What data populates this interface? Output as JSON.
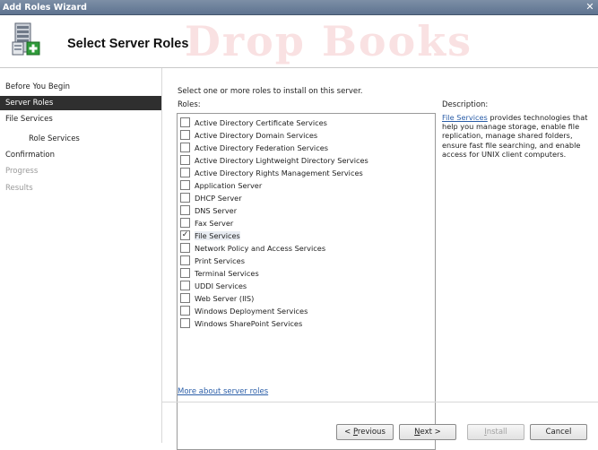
{
  "window": {
    "title": "Add Roles Wizard",
    "close_glyph": "✕"
  },
  "header": {
    "title": "Select Server Roles",
    "icon": "server-roles-wizard-icon"
  },
  "watermark": {
    "text": "Drop Books"
  },
  "nav": {
    "items": [
      {
        "label": "Before You Begin",
        "state": "normal"
      },
      {
        "label": "Server Roles",
        "state": "selected"
      },
      {
        "label": "File Services",
        "state": "normal"
      },
      {
        "label": "Role Services",
        "state": "sub"
      },
      {
        "label": "Confirmation",
        "state": "normal"
      },
      {
        "label": "Progress",
        "state": "disabled"
      },
      {
        "label": "Results",
        "state": "disabled"
      }
    ]
  },
  "main": {
    "instruction": "Select one or more roles to install on this server.",
    "roles_label": "Roles:",
    "roles": [
      {
        "label": "Active Directory Certificate Services",
        "checked": false
      },
      {
        "label": "Active Directory Domain Services",
        "checked": false
      },
      {
        "label": "Active Directory Federation Services",
        "checked": false
      },
      {
        "label": "Active Directory Lightweight Directory Services",
        "checked": false
      },
      {
        "label": "Active Directory Rights Management Services",
        "checked": false
      },
      {
        "label": "Application Server",
        "checked": false
      },
      {
        "label": "DHCP Server",
        "checked": false
      },
      {
        "label": "DNS Server",
        "checked": false
      },
      {
        "label": "Fax Server",
        "checked": false
      },
      {
        "label": "File Services",
        "checked": true
      },
      {
        "label": "Network Policy and Access Services",
        "checked": false
      },
      {
        "label": "Print Services",
        "checked": false
      },
      {
        "label": "Terminal Services",
        "checked": false
      },
      {
        "label": "UDDI Services",
        "checked": false
      },
      {
        "label": "Web Server (IIS)",
        "checked": false
      },
      {
        "label": "Windows Deployment Services",
        "checked": false
      },
      {
        "label": "Windows SharePoint Services",
        "checked": false
      }
    ],
    "description_label": "Description:",
    "description_link": "File Services",
    "description_text": " provides technologies that help you manage storage, enable file replication, manage shared folders, ensure fast file searching, and enable access for UNIX client computers.",
    "more_link": "More about server roles"
  },
  "footer": {
    "previous": {
      "prefix": "< ",
      "accel": "P",
      "rest": "revious"
    },
    "next": {
      "accel": "N",
      "rest": "ext >"
    },
    "install": {
      "accel": "I",
      "rest": "nstall"
    },
    "cancel": "Cancel"
  }
}
